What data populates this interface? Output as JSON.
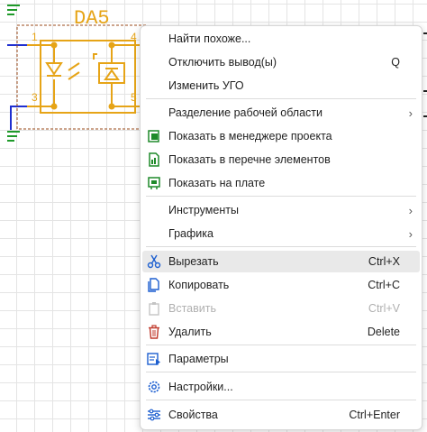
{
  "component": {
    "ref": "DA5",
    "pins": [
      "1",
      "3",
      "4",
      "5"
    ]
  },
  "menu": {
    "items": [
      {
        "label": "Найти похоже...",
        "shortcut": "",
        "submenu": false,
        "icon": "",
        "disabled": false,
        "hover": false
      },
      {
        "label": "Отключить вывод(ы)",
        "shortcut": "Q",
        "submenu": false,
        "icon": "",
        "disabled": false,
        "hover": false
      },
      {
        "label": "Изменить УГО",
        "shortcut": "",
        "submenu": false,
        "icon": "",
        "disabled": false,
        "hover": false
      },
      {
        "label": "Разделение рабочей области",
        "shortcut": "",
        "submenu": true,
        "icon": "",
        "disabled": false,
        "hover": false
      },
      {
        "label": "Показать в менеджере проекта",
        "shortcut": "",
        "submenu": false,
        "icon": "project-manager-icon",
        "disabled": false,
        "hover": false
      },
      {
        "label": "Показать в перечне элементов",
        "shortcut": "",
        "submenu": false,
        "icon": "element-list-icon",
        "disabled": false,
        "hover": false
      },
      {
        "label": "Показать на плате",
        "shortcut": "",
        "submenu": false,
        "icon": "board-icon",
        "disabled": false,
        "hover": false
      },
      {
        "label": "Инструменты",
        "shortcut": "",
        "submenu": true,
        "icon": "",
        "disabled": false,
        "hover": false
      },
      {
        "label": "Графика",
        "shortcut": "",
        "submenu": true,
        "icon": "",
        "disabled": false,
        "hover": false
      },
      {
        "label": "Вырезать",
        "shortcut": "Ctrl+X",
        "submenu": false,
        "icon": "scissors-icon",
        "disabled": false,
        "hover": true
      },
      {
        "label": "Копировать",
        "shortcut": "Ctrl+C",
        "submenu": false,
        "icon": "copy-icon",
        "disabled": false,
        "hover": false
      },
      {
        "label": "Вставить",
        "shortcut": "Ctrl+V",
        "submenu": false,
        "icon": "paste-icon",
        "disabled": true,
        "hover": false
      },
      {
        "label": "Удалить",
        "shortcut": "Delete",
        "submenu": false,
        "icon": "trash-icon",
        "disabled": false,
        "hover": false
      },
      {
        "label": "Параметры",
        "shortcut": "",
        "submenu": false,
        "icon": "parameters-icon",
        "disabled": false,
        "hover": false
      },
      {
        "label": "Настройки...",
        "shortcut": "",
        "submenu": false,
        "icon": "settings-icon",
        "disabled": false,
        "hover": false
      },
      {
        "label": "Свойства",
        "shortcut": "Ctrl+Enter",
        "submenu": false,
        "icon": "properties-icon",
        "disabled": false,
        "hover": false
      }
    ]
  },
  "colors": {
    "component": "#e6a417",
    "selection": "#9a4a1a",
    "wire_blue": "#1f2fd0",
    "ground_green": "#1f9a2a",
    "icon_blue": "#1d5fd0",
    "icon_green": "#1f8a2a",
    "icon_red": "#c0392b"
  }
}
